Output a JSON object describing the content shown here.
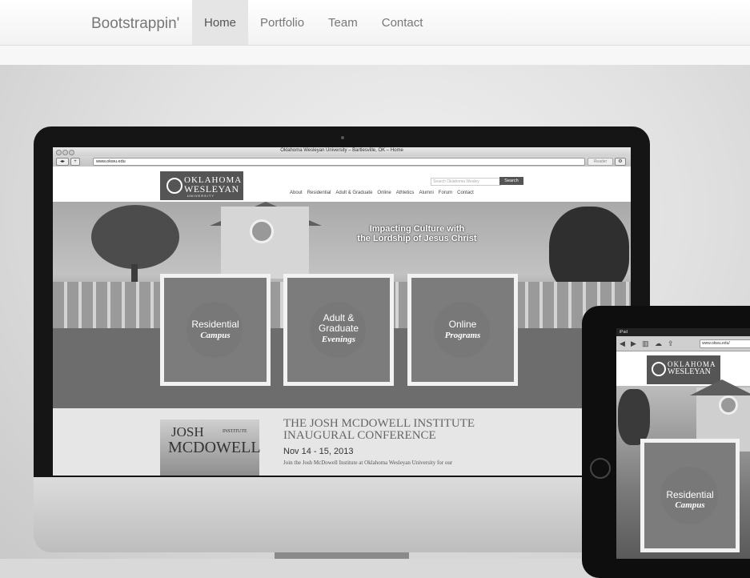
{
  "navbar": {
    "brand": "Bootstrappin'",
    "links": [
      {
        "label": "Home",
        "active": true
      },
      {
        "label": "Portfolio",
        "active": false
      },
      {
        "label": "Team",
        "active": false
      },
      {
        "label": "Contact",
        "active": false
      }
    ]
  },
  "desktop_browser": {
    "window_title": "Oklahoma Wesleyan University – Bartlesville, OK – Home",
    "url": "www.okwu.edu",
    "reader_label": "Reader",
    "site": {
      "logo_line1": "OKLAHOMA",
      "logo_line2": "WESLEYAN",
      "logo_line3": "UNIVERSITY",
      "search_placeholder": "Search Oklahoma Wesley",
      "search_button": "Search",
      "nav": [
        "About",
        "Residential",
        "Adult & Graduate",
        "Online",
        "Athletics",
        "Alumni",
        "Forum",
        "Contact"
      ],
      "tagline_line1": "Impacting Culture with",
      "tagline_line2": "the Lordship of Jesus Christ",
      "tiles": [
        {
          "line1": "Residential",
          "line2": "",
          "line3": "Campus"
        },
        {
          "line1": "Adult &",
          "line2": "Graduate",
          "line3": "Evenings"
        },
        {
          "line1": "Online",
          "line2": "",
          "line3": "Programs"
        }
      ],
      "event": {
        "image_text_a": "JOSH",
        "image_text_b": "INSTITUTE",
        "image_text_c": "MCDOWELL",
        "title_line1": "THE JOSH MCDOWELL INSTITUTE",
        "title_line2": "INAUGURAL CONFERENCE",
        "date": "Nov 14 - 15, 2013",
        "description": "Join the Josh McDowell Institute at Oklahoma Wesleyan University for our"
      }
    }
  },
  "tablet_browser": {
    "status": "iPad",
    "url": "www.okwu.edu/",
    "logo_line1": "OKLAHOMA",
    "logo_line2": "WESLEYAN",
    "tile_line1": "Residential",
    "tile_line2": "Campus"
  }
}
